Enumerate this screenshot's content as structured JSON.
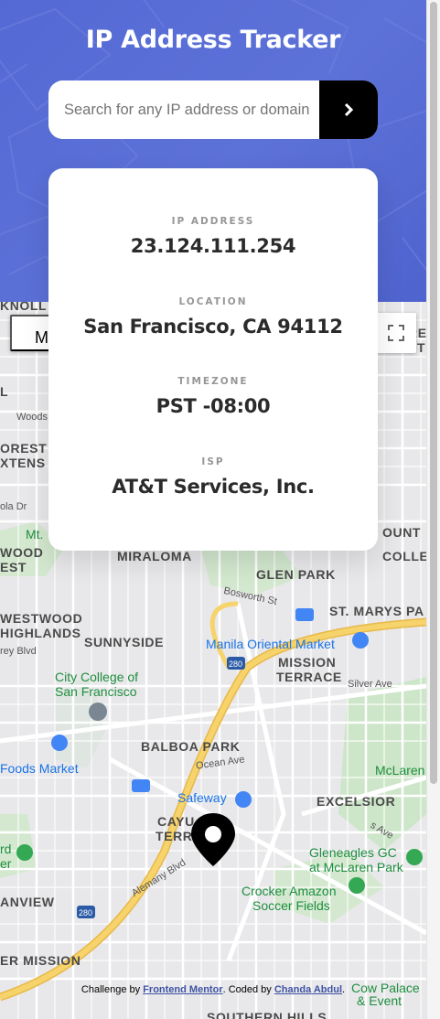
{
  "app": {
    "title": "IP Address Tracker"
  },
  "search": {
    "placeholder": "Search for any IP address or domain",
    "value": "",
    "submit_icon": "chevron-right-icon"
  },
  "results": {
    "ip": {
      "label": "IP ADDRESS",
      "value": "23.124.111.254"
    },
    "location": {
      "label": "LOCATION",
      "value": "San Francisco, CA 94112"
    },
    "timezone": {
      "label": "TIMEZONE",
      "value": "PST -08:00"
    },
    "isp": {
      "label": "ISP",
      "value": "AT&T Services, Inc."
    }
  },
  "map": {
    "type_button_label": "Ma",
    "fullscreen_icon": "fullscreen-icon",
    "marker_icon": "location-pin-icon",
    "labels": {
      "knoll": "KNOLL",
      "woods": "Woods",
      "forest_ext_1": "OREST",
      "forest_ext_2": "XTENS",
      "sola": "ola Dr",
      "mt": "Mt.",
      "wood": "WOOD",
      "est": "EST",
      "miraloma": "MIRALOMA",
      "glen_park": "GLEN PARK",
      "bosworth": "Bosworth St",
      "st_marys": "ST. MARYS PA",
      "westwood": "WESTWOOD",
      "highlands": "HIGHLANDS",
      "sunnyside": "SUNNYSIDE",
      "manila_market": "Manila Oriental Market",
      "mission": "MISSION",
      "terrace": "TERRACE",
      "silver_ave": "Silver Ave",
      "rey_blvd": "rey Blvd",
      "city_college_1": "City College of",
      "city_college_2": "San Francisco",
      "balboa_park": "BALBOA PARK",
      "ocean_ave": "Ocean Ave",
      "foods_market": "Foods Market",
      "mclaren": "McLaren",
      "safeway": "Safeway",
      "excelsior": "EXCELSIOR",
      "cayuga_1": "CAYU",
      "cayuga_2": "TERR",
      "gleneagles_1": "Gleneagles GC",
      "gleneagles_2": "at McLaren Park",
      "rd": "rd",
      "er": "er",
      "alemany": "Alemany Blvd",
      "crocker_1": "Crocker Amazon",
      "crocker_2": "Soccer Fields",
      "anview": "ANVIEW",
      "outer_mission": "ER MISSION",
      "cow_palace_1": "Cow Palace",
      "cow_palace_2": "& Event",
      "hwy_280": "280",
      "ount": "OUNT",
      "colle": "COLLE",
      "re": "RE",
      "t": "T",
      "l": "L",
      "southern_hills": "SOUTHERN HILLS",
      "hwy_ave": "s Ave"
    }
  },
  "attribution": {
    "prefix": "Challenge by ",
    "mentor": "Frontend Mentor",
    "middle": ". Coded by ",
    "author": "Chanda Abdul",
    "suffix": "."
  },
  "colors": {
    "header_bg": "#5a6fd6",
    "button_bg": "#000000",
    "label_gray": "#969696",
    "value_dark": "#2b2b2b",
    "freeway": "#f6c84a",
    "park": "#c8e6c9"
  }
}
